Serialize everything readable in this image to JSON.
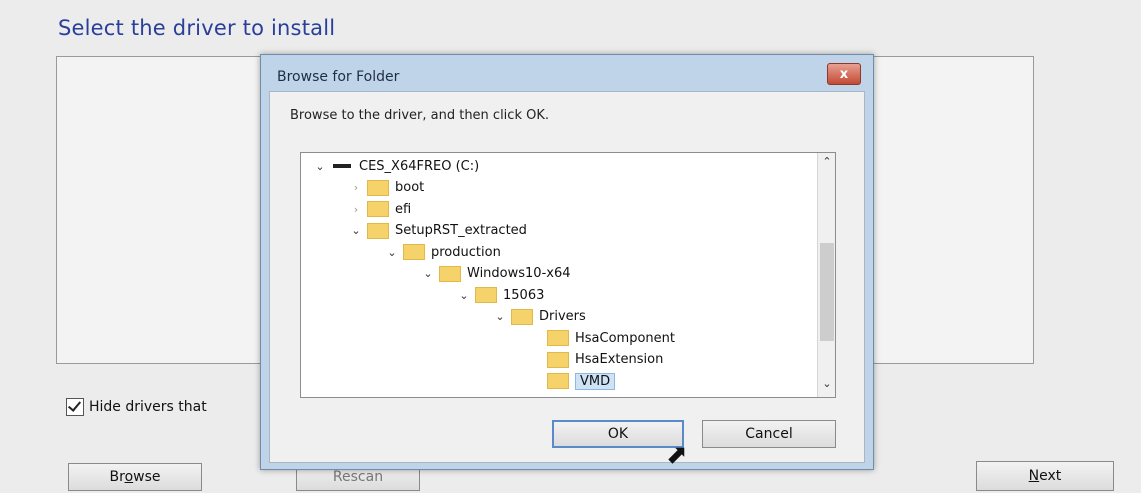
{
  "installer": {
    "heading": "Select the driver to install",
    "hide_checkbox": {
      "label": "Hide drivers that",
      "checked": true
    },
    "buttons": {
      "browse": "Browse",
      "browse_accel": "o",
      "rescan": "Rescan",
      "next": "Next",
      "next_accel": "N"
    }
  },
  "dialog": {
    "title": "Browse for Folder",
    "close_label": "x",
    "instruction": "Browse to the driver, and then click OK.",
    "tree": [
      {
        "label": "CES_X64FREO (C:)",
        "type": "drive",
        "level": 0,
        "expander": "expanded"
      },
      {
        "label": "boot",
        "type": "folder",
        "level": 1,
        "expander": "collapsed"
      },
      {
        "label": "efi",
        "type": "folder",
        "level": 1,
        "expander": "collapsed"
      },
      {
        "label": "SetupRST_extracted",
        "type": "folder",
        "level": 1,
        "expander": "expanded"
      },
      {
        "label": "production",
        "type": "folder",
        "level": 2,
        "expander": "expanded"
      },
      {
        "label": "Windows10-x64",
        "type": "folder",
        "level": 3,
        "expander": "expanded"
      },
      {
        "label": "15063",
        "type": "folder",
        "level": 4,
        "expander": "expanded"
      },
      {
        "label": "Drivers",
        "type": "folder",
        "level": 5,
        "expander": "expanded"
      },
      {
        "label": "HsaComponent",
        "type": "folder",
        "level": 6,
        "expander": "none"
      },
      {
        "label": "HsaExtension",
        "type": "folder",
        "level": 6,
        "expander": "none"
      },
      {
        "label": "VMD",
        "type": "folder",
        "level": 6,
        "expander": "none",
        "selected": true
      }
    ],
    "ok_label": "OK",
    "cancel_label": "Cancel"
  },
  "icons": {
    "expanded": "chevron-down-icon",
    "collapsed": "chevron-right-icon",
    "drive": "drive-icon",
    "folder": "folder-icon",
    "cursor": "mouse-cursor-icon"
  },
  "colors": {
    "heading": "#2a3f9a",
    "folder": "#f6d26a",
    "close": "#c34a35",
    "selection": "#cfe3f7"
  }
}
